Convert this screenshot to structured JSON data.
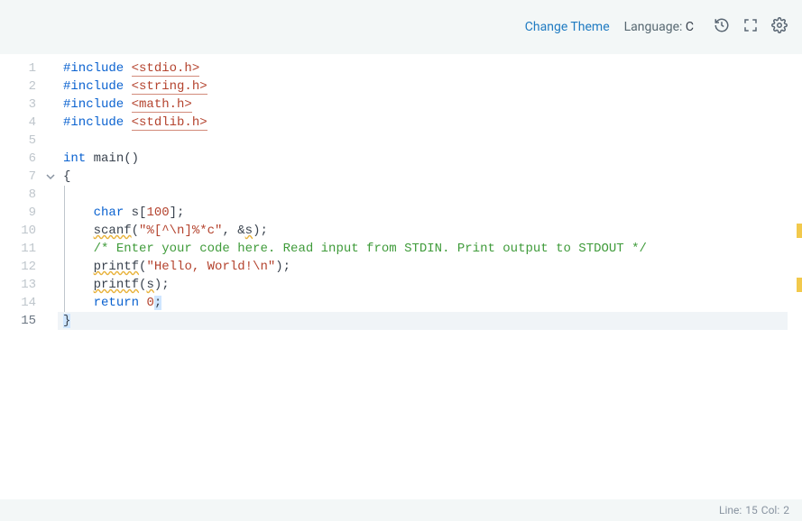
{
  "toolbar": {
    "change_theme": "Change Theme",
    "language_label": "Language:",
    "language_value": "C"
  },
  "status": {
    "line_label": "Line:",
    "line_value": "15",
    "col_label": "Col:",
    "col_value": "2"
  },
  "editor": {
    "active_line": 15,
    "markers_at": [
      10,
      13
    ],
    "fold_at_line": 7,
    "lines": [
      {
        "n": 1,
        "tokens": [
          [
            "kw",
            "#include "
          ],
          [
            "hdr-ul",
            "<stdio.h>"
          ]
        ]
      },
      {
        "n": 2,
        "tokens": [
          [
            "kw",
            "#include "
          ],
          [
            "hdr-ul",
            "<string.h>"
          ]
        ]
      },
      {
        "n": 3,
        "tokens": [
          [
            "kw",
            "#include "
          ],
          [
            "hdr-ul",
            "<math.h>"
          ]
        ]
      },
      {
        "n": 4,
        "tokens": [
          [
            "kw",
            "#include "
          ],
          [
            "hdr-ul",
            "<stdlib.h>"
          ]
        ]
      },
      {
        "n": 5,
        "tokens": [
          [
            "",
            ""
          ]
        ]
      },
      {
        "n": 6,
        "tokens": [
          [
            "kw",
            "int"
          ],
          [
            "",
            " "
          ],
          [
            "id",
            "main"
          ],
          [
            "punc",
            "()"
          ]
        ]
      },
      {
        "n": 7,
        "tokens": [
          [
            "punc",
            "{"
          ]
        ]
      },
      {
        "n": 8,
        "tokens": [
          [
            "",
            ""
          ]
        ]
      },
      {
        "n": 9,
        "tokens": [
          [
            "",
            "    "
          ],
          [
            "kw",
            "char"
          ],
          [
            "",
            " "
          ],
          [
            "id",
            "s"
          ],
          [
            "punc",
            "["
          ],
          [
            "num",
            "100"
          ],
          [
            "punc",
            "];"
          ]
        ]
      },
      {
        "n": 10,
        "tokens": [
          [
            "",
            "    "
          ],
          [
            "wavy",
            "scanf"
          ],
          [
            "punc",
            "("
          ],
          [
            "str",
            "\"%[^\\n]%*c\""
          ],
          [
            "punc",
            ", &"
          ],
          [
            "wavy",
            "s"
          ],
          [
            "punc",
            ");"
          ]
        ]
      },
      {
        "n": 11,
        "tokens": [
          [
            "",
            "    "
          ],
          [
            "com",
            "/* Enter your code here. Read input from STDIN. Print output to STDOUT */"
          ]
        ]
      },
      {
        "n": 12,
        "tokens": [
          [
            "",
            "    "
          ],
          [
            "wavy",
            "printf"
          ],
          [
            "punc",
            "("
          ],
          [
            "str",
            "\"Hello, World!\\n\""
          ],
          [
            "punc",
            ");"
          ]
        ]
      },
      {
        "n": 13,
        "tokens": [
          [
            "",
            "    "
          ],
          [
            "wavy",
            "printf"
          ],
          [
            "punc",
            "("
          ],
          [
            "wavy",
            "s"
          ],
          [
            "punc",
            ");"
          ]
        ]
      },
      {
        "n": 14,
        "tokens": [
          [
            "",
            "    "
          ],
          [
            "kw",
            "return"
          ],
          [
            "",
            " "
          ],
          [
            "num",
            "0"
          ],
          [
            "sel",
            ";"
          ]
        ]
      },
      {
        "n": 15,
        "tokens": [
          [
            "sel",
            "}"
          ]
        ]
      }
    ]
  }
}
